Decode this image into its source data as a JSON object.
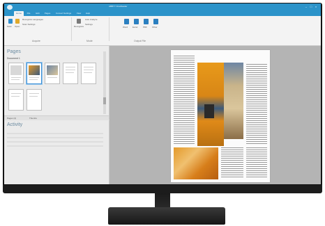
{
  "window": {
    "title": "ABBYY FineReader"
  },
  "tabs": [
    {
      "label": "Home"
    },
    {
      "label": "File"
    },
    {
      "label": "Edit"
    },
    {
      "label": "Pages"
    },
    {
      "label": "Convert Settings"
    },
    {
      "label": "View"
    },
    {
      "label": "Help"
    }
  ],
  "ribbon": {
    "acquire": {
      "label": "Acquire",
      "scan": "Scan",
      "open": "Open",
      "recognize": "Recognize Languages",
      "scan_opts": "Scan Settings"
    },
    "mode": {
      "label": "Mode",
      "recognize": "Recognize",
      "auto": "Auto Analyze",
      "settings": "Settings"
    },
    "output": {
      "label": "Output File",
      "items": [
        "Word",
        "Excel",
        "PDF",
        "Other"
      ]
    }
  },
  "pages_panel": {
    "title": "Pages",
    "document": "Document 1",
    "pager_left": "Pages (4)",
    "pager_right": "Thumbs"
  },
  "activity_panel": {
    "title": "Activity"
  },
  "colors": {
    "accent": "#2b93c9",
    "photo_orange": "#e08a18"
  }
}
